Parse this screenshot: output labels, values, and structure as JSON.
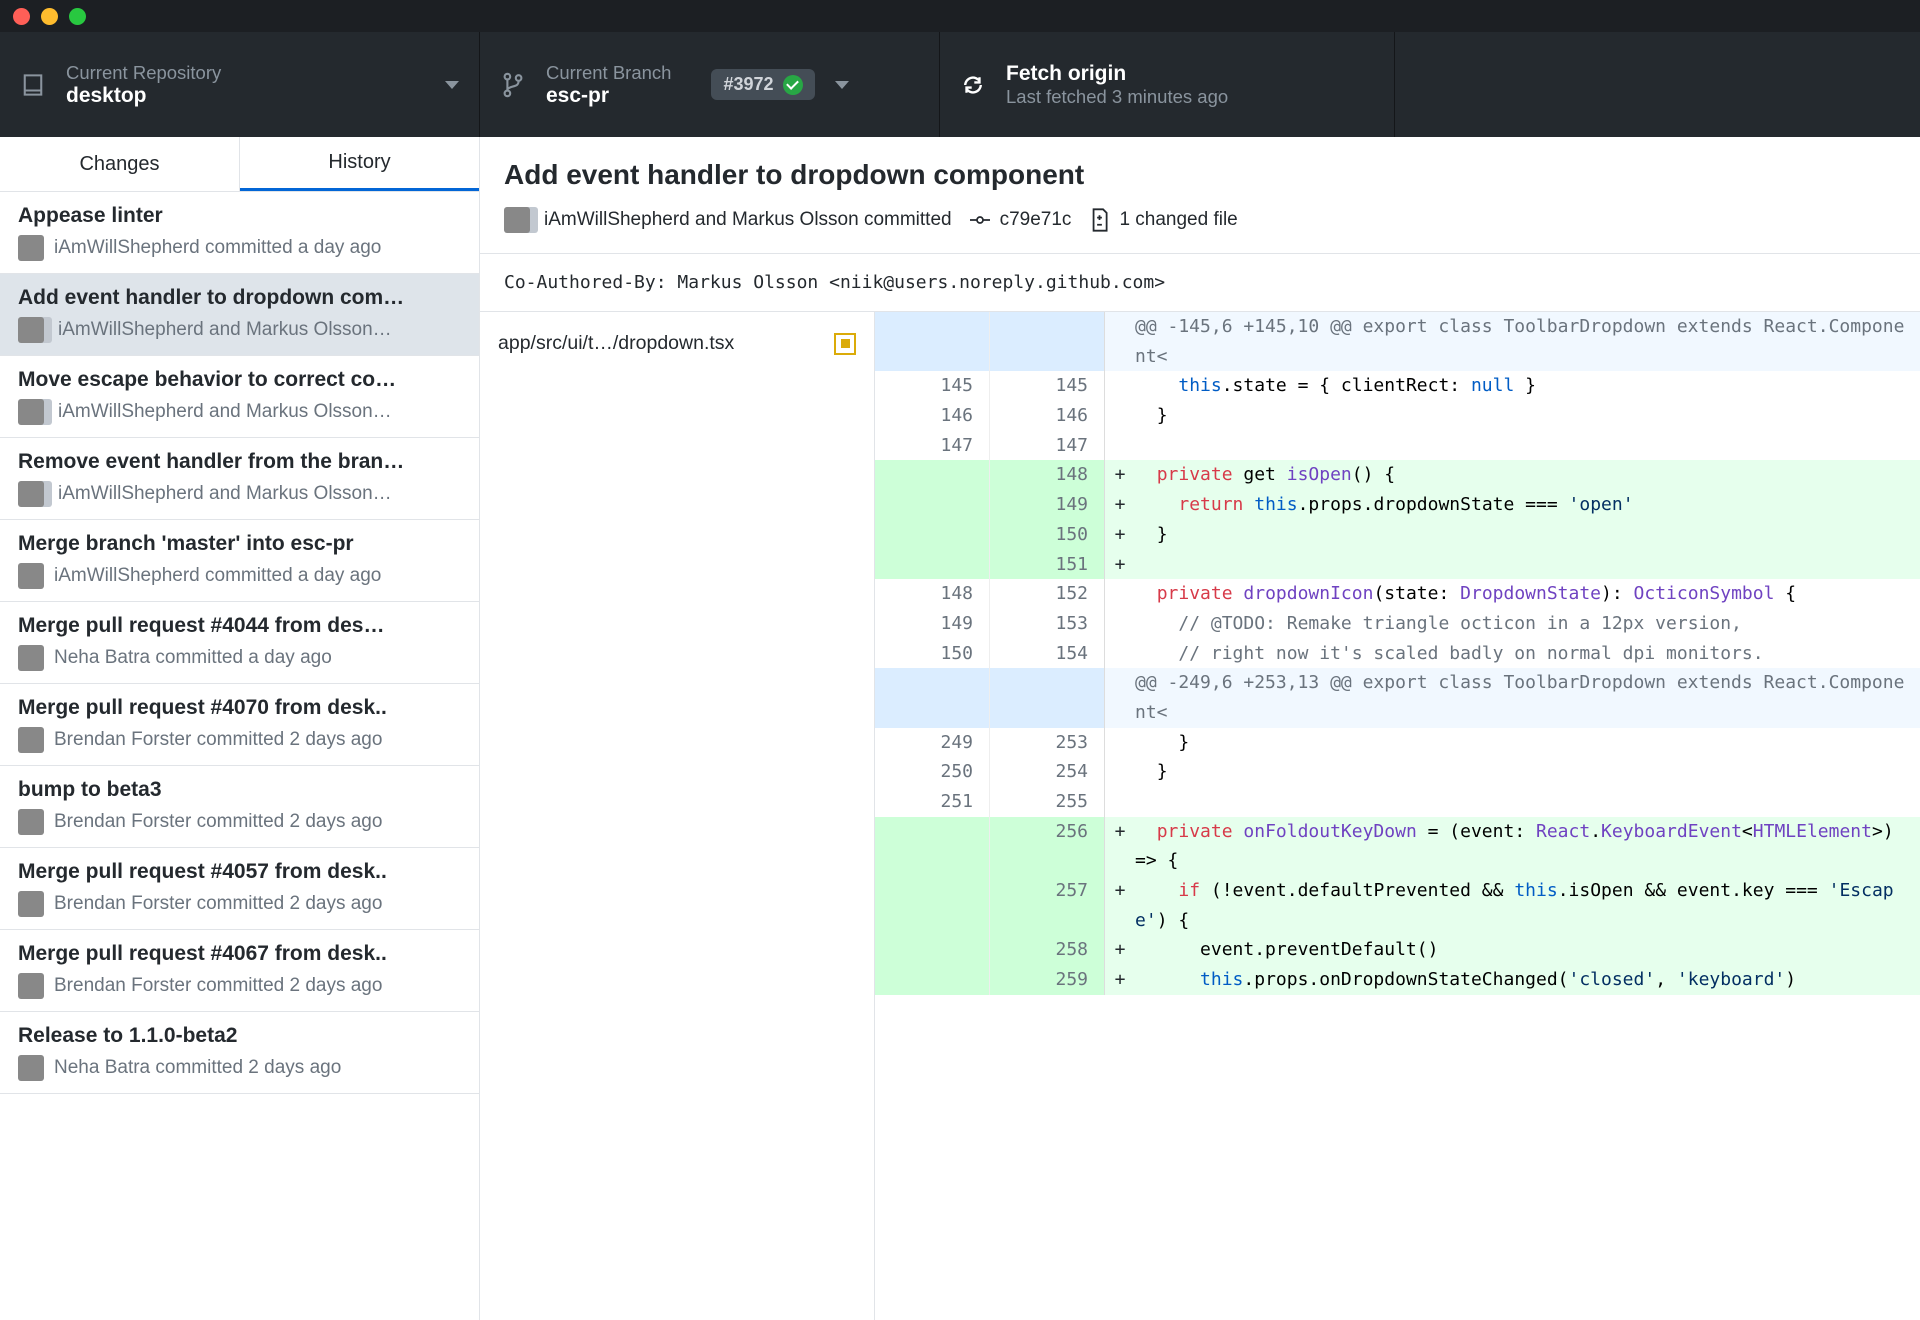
{
  "titlebar": {},
  "toolbar": {
    "repo": {
      "label": "Current Repository",
      "value": "desktop"
    },
    "branch": {
      "label": "Current Branch",
      "value": "esc-pr",
      "pr_badge": "#3972"
    },
    "fetch": {
      "label": "Fetch origin",
      "sub": "Last fetched 3 minutes ago"
    }
  },
  "tabs": {
    "changes": "Changes",
    "history": "History"
  },
  "history": [
    {
      "title": "Appease linter",
      "sub": "iAmWillShepherd committed a day ago",
      "pair": false
    },
    {
      "title": "Add event handler to dropdown com…",
      "sub": "iAmWillShepherd and Markus Olsson…",
      "pair": true,
      "selected": true
    },
    {
      "title": "Move escape behavior to correct co…",
      "sub": "iAmWillShepherd and Markus Olsson…",
      "pair": true
    },
    {
      "title": "Remove event handler from the bran…",
      "sub": "iAmWillShepherd and Markus Olsson…",
      "pair": true
    },
    {
      "title": "Merge branch 'master' into esc-pr",
      "sub": "iAmWillShepherd committed a day ago",
      "pair": false
    },
    {
      "title": "Merge pull request #4044 from des…",
      "sub": "Neha Batra committed a day ago",
      "pair": false
    },
    {
      "title": "Merge pull request #4070 from desk..",
      "sub": "Brendan Forster committed 2 days ago",
      "pair": false
    },
    {
      "title": "bump to beta3",
      "sub": "Brendan Forster committed 2 days ago",
      "pair": false
    },
    {
      "title": "Merge pull request #4057 from desk..",
      "sub": "Brendan Forster committed 2 days ago",
      "pair": false
    },
    {
      "title": "Merge pull request #4067 from desk..",
      "sub": "Brendan Forster committed 2 days ago",
      "pair": false
    },
    {
      "title": "Release to 1.1.0-beta2",
      "sub": "Neha Batra committed 2 days ago",
      "pair": false
    }
  ],
  "detail": {
    "title": "Add event handler to dropdown component",
    "authors": "iAmWillShepherd and Markus Olsson committed",
    "sha": "c79e71c",
    "changed": "1 changed file",
    "message": "Co-Authored-By: Markus Olsson <niik@users.noreply.github.com>",
    "file": "app/src/ui/t…/dropdown.tsx"
  },
  "diff": [
    {
      "type": "hunk",
      "old": "",
      "new": "",
      "sign": "",
      "segs": [
        {
          "t": "@@ -145,6 +145,10 @@ export class ToolbarDropdown extends React.Component<",
          "c": ""
        }
      ]
    },
    {
      "type": "ctx",
      "old": "145",
      "new": "145",
      "sign": "",
      "segs": [
        {
          "t": "    ",
          "c": ""
        },
        {
          "t": "this",
          "c": "kw-blue"
        },
        {
          "t": ".state = { clientRect: ",
          "c": ""
        },
        {
          "t": "null",
          "c": "kw-blue"
        },
        {
          "t": " }",
          "c": ""
        }
      ]
    },
    {
      "type": "ctx",
      "old": "146",
      "new": "146",
      "sign": "",
      "segs": [
        {
          "t": "  }",
          "c": ""
        }
      ]
    },
    {
      "type": "ctx",
      "old": "147",
      "new": "147",
      "sign": "",
      "segs": [
        {
          "t": "",
          "c": ""
        }
      ]
    },
    {
      "type": "add",
      "old": "",
      "new": "148",
      "sign": "+",
      "segs": [
        {
          "t": "  ",
          "c": ""
        },
        {
          "t": "private",
          "c": "kw-red"
        },
        {
          "t": " get ",
          "c": ""
        },
        {
          "t": "isOpen",
          "c": "kw-purple"
        },
        {
          "t": "() {",
          "c": ""
        }
      ]
    },
    {
      "type": "add",
      "old": "",
      "new": "149",
      "sign": "+",
      "segs": [
        {
          "t": "    ",
          "c": ""
        },
        {
          "t": "return",
          "c": "kw-red"
        },
        {
          "t": " ",
          "c": ""
        },
        {
          "t": "this",
          "c": "kw-blue"
        },
        {
          "t": ".props.dropdownState === ",
          "c": ""
        },
        {
          "t": "'open'",
          "c": "kw-str"
        }
      ]
    },
    {
      "type": "add",
      "old": "",
      "new": "150",
      "sign": "+",
      "segs": [
        {
          "t": "  }",
          "c": ""
        }
      ]
    },
    {
      "type": "add",
      "old": "",
      "new": "151",
      "sign": "+",
      "segs": [
        {
          "t": "",
          "c": ""
        }
      ]
    },
    {
      "type": "ctx",
      "old": "148",
      "new": "152",
      "sign": "",
      "segs": [
        {
          "t": "  ",
          "c": ""
        },
        {
          "t": "private",
          "c": "kw-red"
        },
        {
          "t": " ",
          "c": ""
        },
        {
          "t": "dropdownIcon",
          "c": "kw-purple"
        },
        {
          "t": "(state: ",
          "c": ""
        },
        {
          "t": "DropdownState",
          "c": "kw-purple"
        },
        {
          "t": "): ",
          "c": ""
        },
        {
          "t": "OcticonSymbol",
          "c": "kw-purple"
        },
        {
          "t": " {",
          "c": ""
        }
      ]
    },
    {
      "type": "ctx",
      "old": "149",
      "new": "153",
      "sign": "",
      "segs": [
        {
          "t": "    ",
          "c": ""
        },
        {
          "t": "// @TODO: Remake triangle octicon in a 12px version,",
          "c": "kw-comment"
        }
      ]
    },
    {
      "type": "ctx",
      "old": "150",
      "new": "154",
      "sign": "",
      "segs": [
        {
          "t": "    ",
          "c": ""
        },
        {
          "t": "// right now it's scaled badly on normal dpi monitors.",
          "c": "kw-comment"
        }
      ]
    },
    {
      "type": "hunk",
      "old": "",
      "new": "",
      "sign": "",
      "segs": [
        {
          "t": "@@ -249,6 +253,13 @@ export class ToolbarDropdown extends React.Component<",
          "c": ""
        }
      ]
    },
    {
      "type": "ctx",
      "old": "249",
      "new": "253",
      "sign": "",
      "segs": [
        {
          "t": "    }",
          "c": ""
        }
      ]
    },
    {
      "type": "ctx",
      "old": "250",
      "new": "254",
      "sign": "",
      "segs": [
        {
          "t": "  }",
          "c": ""
        }
      ]
    },
    {
      "type": "ctx",
      "old": "251",
      "new": "255",
      "sign": "",
      "segs": [
        {
          "t": "",
          "c": ""
        }
      ]
    },
    {
      "type": "add",
      "old": "",
      "new": "256",
      "sign": "+",
      "segs": [
        {
          "t": "  ",
          "c": ""
        },
        {
          "t": "private",
          "c": "kw-red"
        },
        {
          "t": " ",
          "c": ""
        },
        {
          "t": "onFoldoutKeyDown",
          "c": "kw-purple"
        },
        {
          "t": " = (event: ",
          "c": ""
        },
        {
          "t": "React",
          "c": "kw-purple"
        },
        {
          "t": ".",
          "c": ""
        },
        {
          "t": "KeyboardEvent",
          "c": "kw-purple"
        },
        {
          "t": "<",
          "c": ""
        },
        {
          "t": "HTMLElement",
          "c": "kw-purple"
        },
        {
          "t": ">) => {",
          "c": ""
        }
      ]
    },
    {
      "type": "add",
      "old": "",
      "new": "257",
      "sign": "+",
      "segs": [
        {
          "t": "    ",
          "c": ""
        },
        {
          "t": "if",
          "c": "kw-red"
        },
        {
          "t": " (!event.defaultPrevented && ",
          "c": ""
        },
        {
          "t": "this",
          "c": "kw-blue"
        },
        {
          "t": ".isOpen && event.key === ",
          "c": ""
        },
        {
          "t": "'Escape'",
          "c": "kw-str"
        },
        {
          "t": ") {",
          "c": ""
        }
      ]
    },
    {
      "type": "add",
      "old": "",
      "new": "258",
      "sign": "+",
      "segs": [
        {
          "t": "      event.preventDefault()",
          "c": ""
        }
      ]
    },
    {
      "type": "add",
      "old": "",
      "new": "259",
      "sign": "+",
      "segs": [
        {
          "t": "      ",
          "c": ""
        },
        {
          "t": "this",
          "c": "kw-blue"
        },
        {
          "t": ".props.onDropdownStateChanged(",
          "c": ""
        },
        {
          "t": "'closed'",
          "c": "kw-str"
        },
        {
          "t": ", ",
          "c": ""
        },
        {
          "t": "'keyboard'",
          "c": "kw-str"
        },
        {
          "t": ")",
          "c": ""
        }
      ]
    }
  ]
}
